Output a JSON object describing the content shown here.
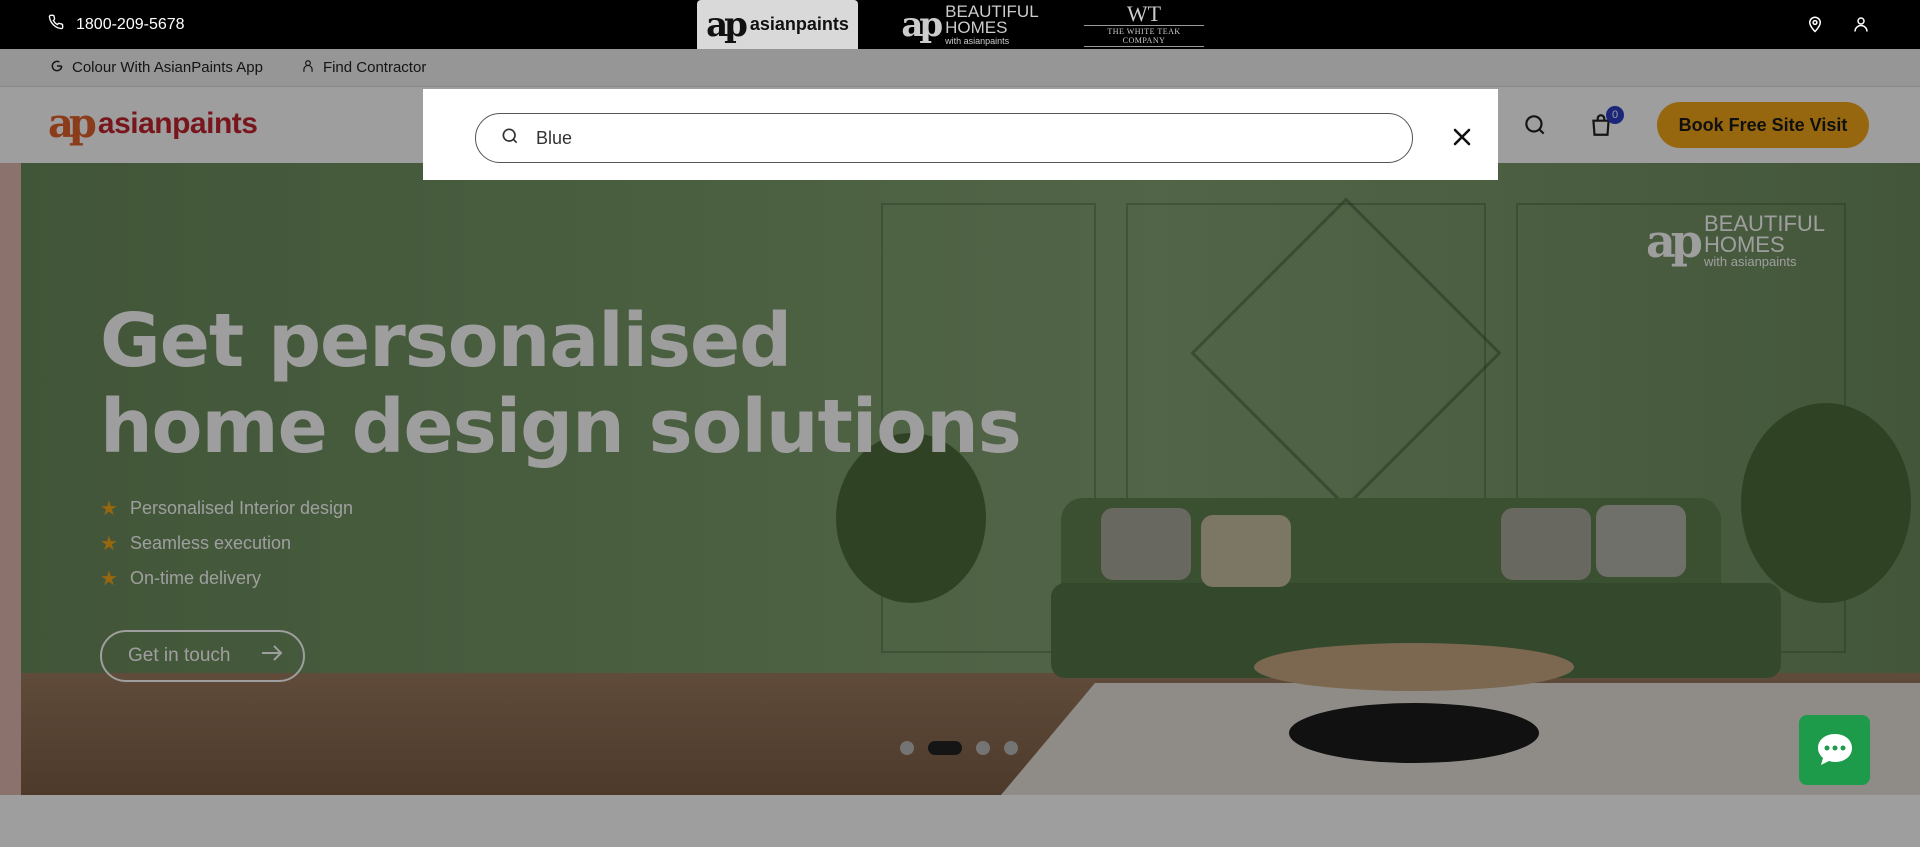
{
  "topbar": {
    "phone": "1800-209-5678",
    "brands": {
      "asianpaints": "asianpaints",
      "beautiful_homes_line1": "BEAUTIFUL",
      "beautiful_homes_line2": "HOMES",
      "beautiful_homes_line3": "with asianpaints",
      "white_teak_mono": "WT",
      "white_teak_name": "THE WHITE TEAK COMPANY"
    }
  },
  "subbar": {
    "app_link": "Colour With AsianPaints App",
    "contractor_link": "Find Contractor"
  },
  "header": {
    "logo_text": "asianpaints",
    "cart_count": "0",
    "book_button": "Book Free Site Visit"
  },
  "search": {
    "value": "Blue"
  },
  "hero": {
    "title_line1": "Get personalised",
    "title_line2": "home design solutions",
    "bullets": [
      "Personalised Interior design",
      "Seamless execution",
      "On-time delivery"
    ],
    "cta": "Get in touch",
    "watermark_line1": "BEAUTIFUL",
    "watermark_line2": "HOMES",
    "watermark_line3": "with asianpaints",
    "slide_count": 4,
    "active_slide": 2
  },
  "colors": {
    "accent": "#f3a619",
    "brand_red": "#c2252f",
    "brand_orange": "#e0612a",
    "chat_green": "#1e9a4b",
    "badge_blue": "#2d3ec4"
  },
  "icons": [
    "phone-icon",
    "location-icon",
    "user-icon",
    "app-icon",
    "contractor-icon",
    "search-icon",
    "cart-icon",
    "close-icon",
    "star-icon",
    "arrow-right-icon",
    "chat-icon"
  ]
}
